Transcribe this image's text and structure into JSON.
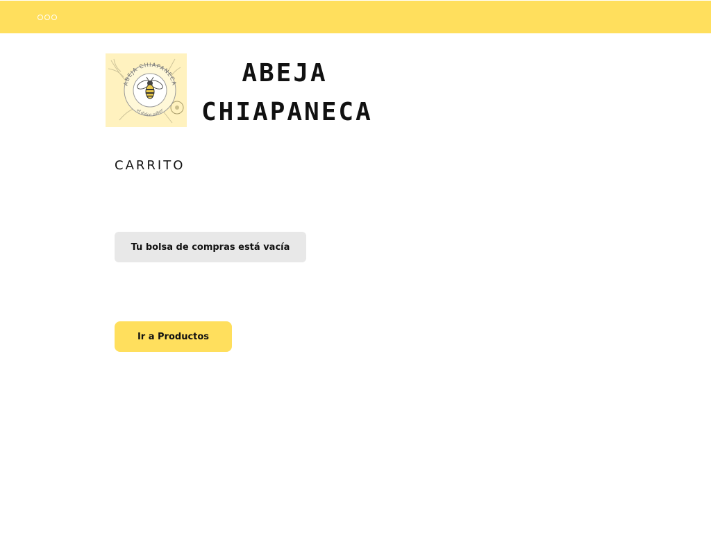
{
  "header": {
    "menu_icon": "more-dots-icon",
    "background": "#ffdf5d"
  },
  "brand": {
    "logo_icon": "bee-logo-icon",
    "logo_text_top": "ABEJA CHIAPANECA",
    "logo_text_bottom": "el dulce sabor",
    "name_line1": "ABEJA",
    "name_line2": "CHIAPANECA"
  },
  "cart": {
    "title": "CARRITO",
    "empty_message": "Tu bolsa de compras está vacía",
    "go_to_products_label": "Ir a Productos",
    "accent": "#ffdf5d",
    "message_bg": "#e8e8e8"
  }
}
